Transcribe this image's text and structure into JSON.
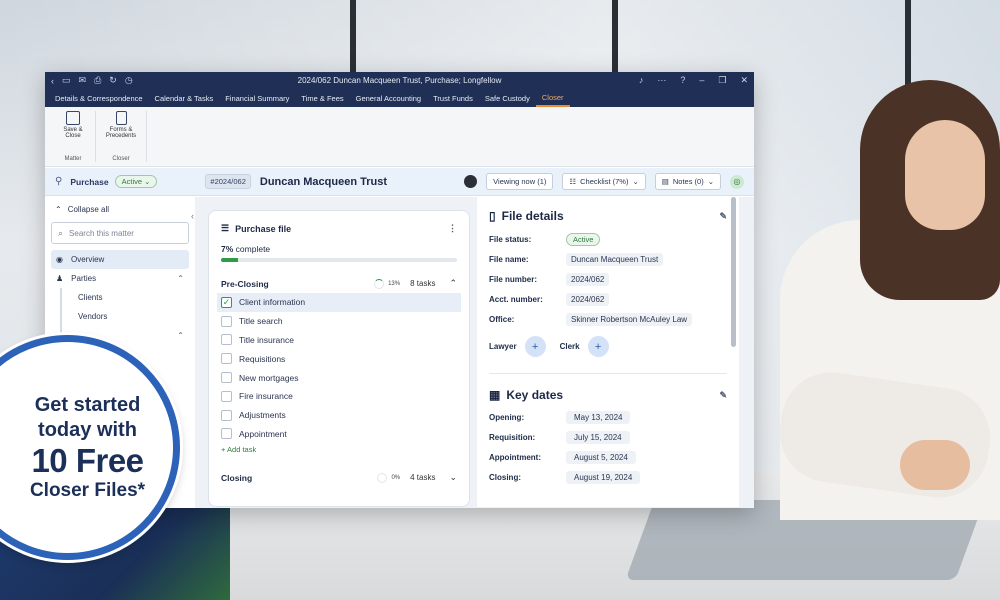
{
  "window": {
    "title": "2024/062 Duncan Macqueen Trust, Purchase; Longfellow"
  },
  "menu": [
    {
      "label": "Details & Correspondence"
    },
    {
      "label": "Calendar & Tasks"
    },
    {
      "label": "Financial Summary"
    },
    {
      "label": "Time & Fees"
    },
    {
      "label": "General Accounting"
    },
    {
      "label": "Trust Funds"
    },
    {
      "label": "Safe Custody"
    },
    {
      "label": "Closer",
      "active": true
    }
  ],
  "ribbon": {
    "save_close": "Save & Close",
    "matter_group": "Matter",
    "forms": "Forms & Precedents",
    "closer_group": "Closer"
  },
  "matter": {
    "type": "Purchase",
    "status": "Active",
    "number": "#2024/062",
    "name": "Duncan Macqueen Trust",
    "viewing": "Viewing now (1)",
    "checklist": "Checklist (7%)",
    "notes": "Notes (0)"
  },
  "sidebar": {
    "collapse_all": "Collapse all",
    "search_placeholder": "Search this matter",
    "items": [
      {
        "label": "Overview"
      },
      {
        "label": "Parties"
      },
      {
        "label": "Clients"
      },
      {
        "label": "Vendors"
      }
    ]
  },
  "purchase_file": {
    "title": "Purchase file",
    "complete_pct": "7%",
    "complete_word": "complete",
    "progress": 0.07,
    "pre_closing": {
      "label": "Pre-Closing",
      "pct": "13%",
      "tasks": "8 tasks",
      "items": [
        {
          "label": "Client information",
          "done": true
        },
        {
          "label": "Title search",
          "done": false
        },
        {
          "label": "Title insurance",
          "done": false
        },
        {
          "label": "Requisitions",
          "done": false
        },
        {
          "label": "New mortgages",
          "done": false
        },
        {
          "label": "Fire insurance",
          "done": false
        },
        {
          "label": "Adjustments",
          "done": false
        },
        {
          "label": "Appointment",
          "done": false
        }
      ],
      "add_task": "+ Add task"
    },
    "closing": {
      "label": "Closing",
      "pct": "0%",
      "tasks": "4 tasks"
    }
  },
  "file_details": {
    "title": "File details",
    "status_label": "File status:",
    "status_value": "Active",
    "name_label": "File name:",
    "name_value": "Duncan Macqueen Trust",
    "number_label": "File number:",
    "number_value": "2024/062",
    "acct_label": "Acct. number:",
    "acct_value": "2024/062",
    "office_label": "Office:",
    "office_value": "Skinner Robertson McAuley Law",
    "lawyer_label": "Lawyer",
    "clerk_label": "Clerk"
  },
  "key_dates": {
    "title": "Key dates",
    "opening_label": "Opening:",
    "opening_value": "May 13, 2024",
    "requisition_label": "Requisition:",
    "requisition_value": "July 15, 2024",
    "appointment_label": "Appointment:",
    "appointment_value": "August 5, 2024",
    "closing_label": "Closing:",
    "closing_value": "August 19, 2024"
  },
  "promo": {
    "line1": "Get started",
    "line2": "today with",
    "line3": "10 Free",
    "line4": "Closer Files*"
  },
  "colors": {
    "titlebar": "#1f2f55",
    "accent_orange": "#f08a2a",
    "progress_green": "#2d9b48",
    "promo_navy": "#1b2f59"
  }
}
